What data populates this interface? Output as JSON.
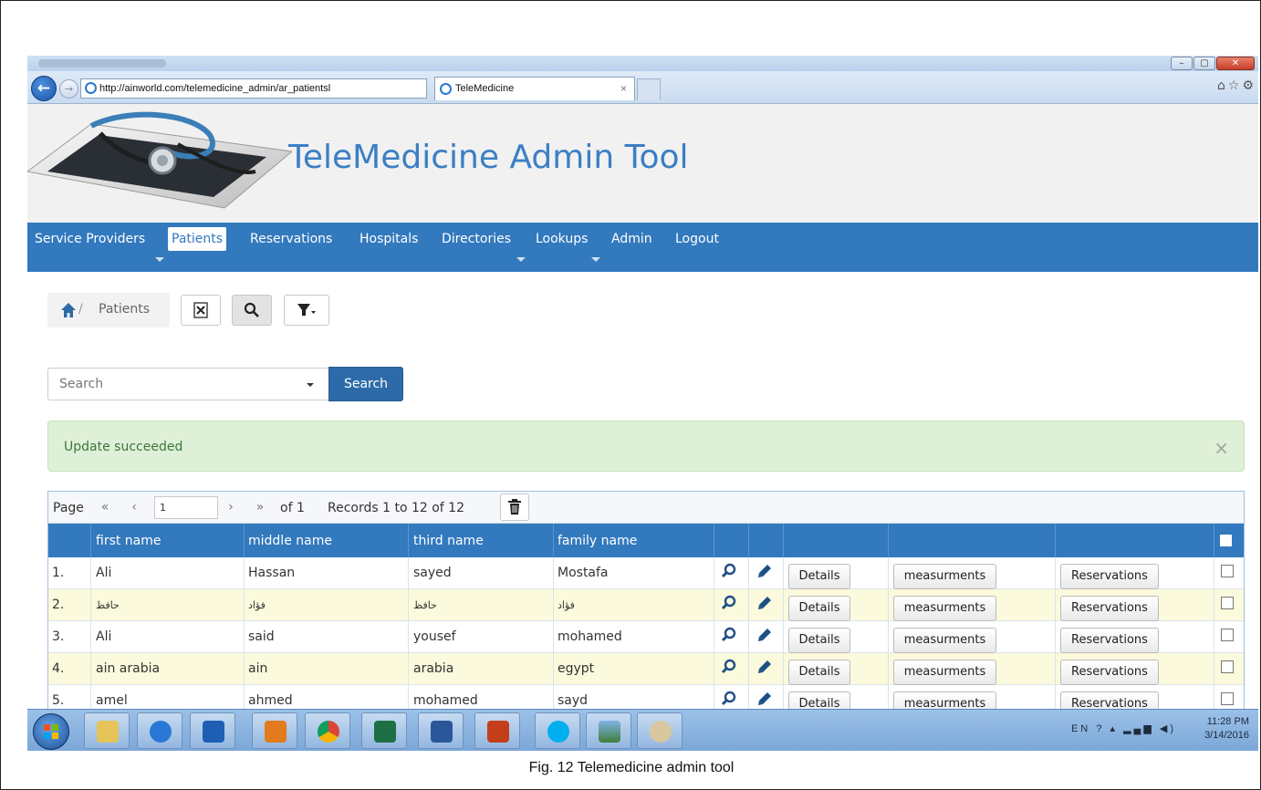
{
  "browser": {
    "url": "http://ainworld.com/telemedicine_admin/ar_patientsl",
    "address_tools": "⌕ ▾ ↻",
    "tab_title": "TeleMedicine",
    "tab_close": "×",
    "window_buttons": [
      "–",
      "▢",
      "✕"
    ]
  },
  "header": {
    "title": "TeleMedicine Admin Tool"
  },
  "nav": {
    "items": [
      {
        "label": "Service Providers",
        "has_dropdown": true
      },
      {
        "label": "Patients",
        "active": true
      },
      {
        "label": "Reservations"
      },
      {
        "label": "Hospitals"
      },
      {
        "label": "Directories",
        "has_dropdown": true
      },
      {
        "label": "Lookups",
        "has_dropdown": true
      },
      {
        "label": "Admin"
      },
      {
        "label": "Logout"
      }
    ]
  },
  "breadcrumb": {
    "separator": "/",
    "current": "Patients"
  },
  "search": {
    "placeholder": "Search",
    "button": "Search"
  },
  "alert": {
    "message": "Update succeeded",
    "close": "×"
  },
  "pager": {
    "page_label": "Page",
    "first": "«",
    "prev": "‹",
    "next": "›",
    "last": "»",
    "current_page": "1",
    "of_label": "of 1",
    "records_label": "Records 1 to 12 of 12"
  },
  "table": {
    "headers": [
      "first name",
      "middle name",
      "third name",
      "family name"
    ],
    "buttons": {
      "details": "Details",
      "measurements": "measurments",
      "reservations": "Reservations"
    },
    "rows": [
      {
        "num": "1.",
        "first": "Ali",
        "middle": "Hassan",
        "third": "sayed",
        "family": "Mostafa",
        "arabic": false
      },
      {
        "num": "2.",
        "first": "حافظ",
        "middle": "فؤاد",
        "third": "حافظ",
        "family": "فؤاد",
        "arabic": true
      },
      {
        "num": "3.",
        "first": "Ali",
        "middle": "said",
        "third": "yousef",
        "family": "mohamed",
        "arabic": false
      },
      {
        "num": "4.",
        "first": "ain arabia",
        "middle": "ain",
        "third": "arabia",
        "family": "egypt",
        "arabic": false
      },
      {
        "num": "5.",
        "first": "amel",
        "middle": "ahmed",
        "third": "mohamed",
        "family": "sayd",
        "arabic": false
      }
    ]
  },
  "taskbar": {
    "apps": [
      "explorer",
      "internet-explorer",
      "outlook",
      "media-player",
      "chrome",
      "excel",
      "word",
      "powerpoint",
      "skype",
      "photos",
      "paint"
    ],
    "lang": "EN",
    "time": "11:28 PM",
    "date": "3/14/2016"
  },
  "caption": "Fig. 12 Telemedicine admin tool",
  "colors": {
    "nav_bg": "#3279be",
    "title": "#3b7fc4",
    "alert_bg": "#dff0d8",
    "alert_text": "#3c763d",
    "search_btn": "#2d6ba8",
    "alt_row": "#fbfadc"
  }
}
